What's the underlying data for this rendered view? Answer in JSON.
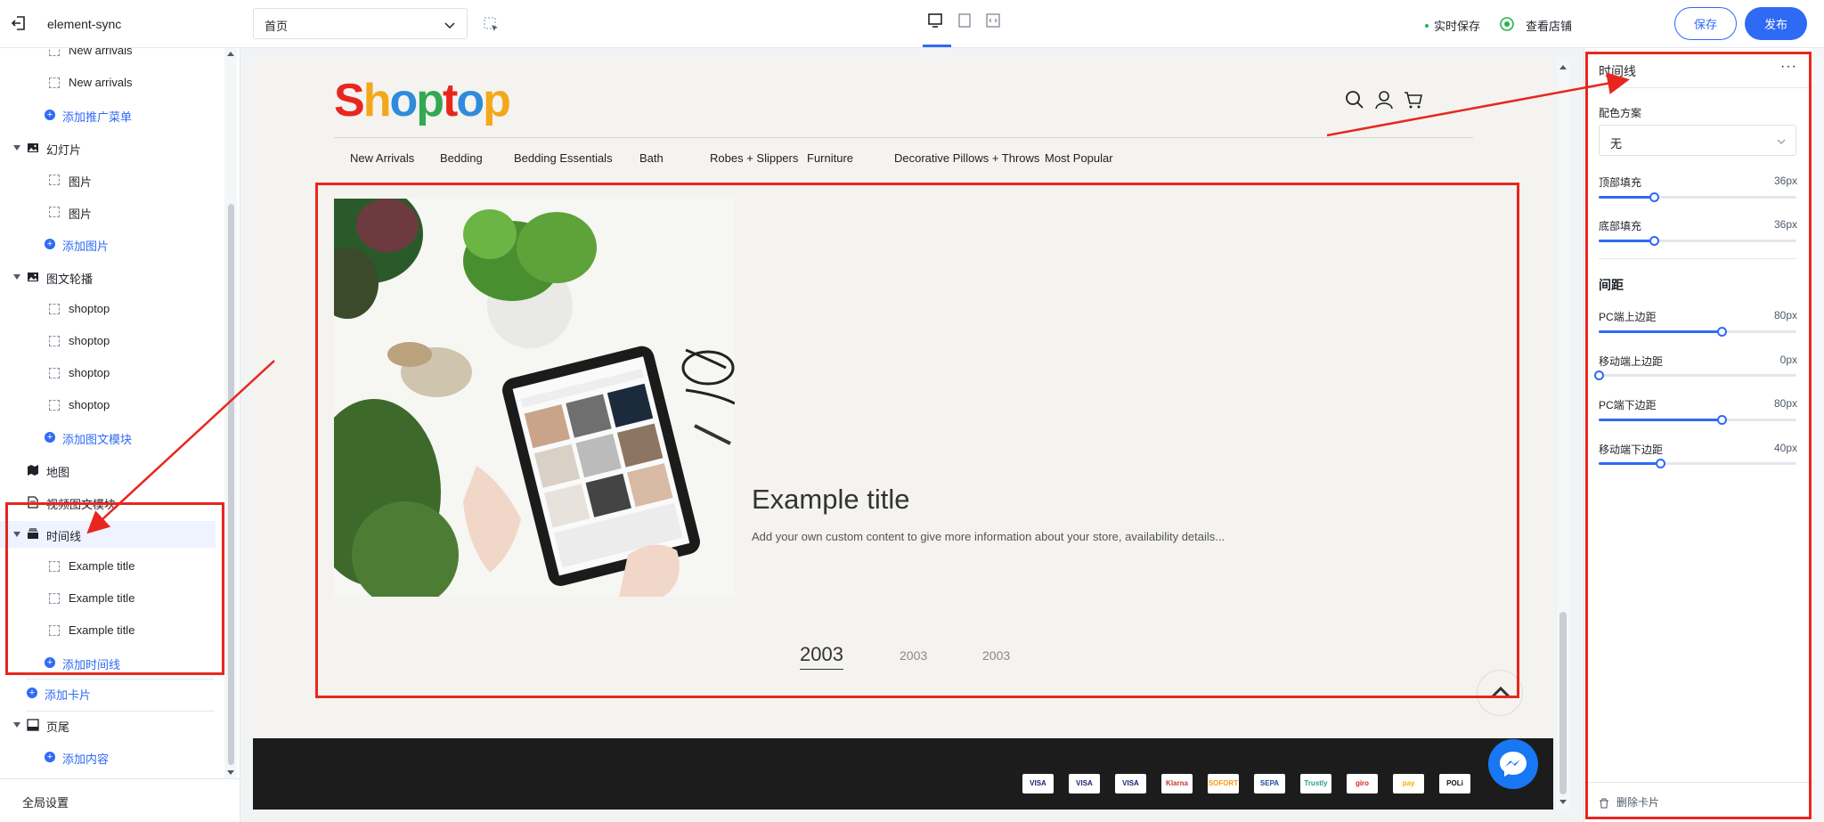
{
  "app": {
    "name": "element-sync"
  },
  "topbar": {
    "page_select": "首页",
    "realtime_save": "实时保存",
    "view_store": "查看店铺",
    "save": "保存",
    "publish": "发布"
  },
  "sidebar": {
    "rows": [
      {
        "kind": "child",
        "label": "New arrivals"
      },
      {
        "kind": "child",
        "label": "New arrivals"
      },
      {
        "kind": "add",
        "label": "添加推广菜单"
      },
      {
        "kind": "section",
        "label": "幻灯片",
        "icon": "image-icon",
        "expanded": true
      },
      {
        "kind": "child",
        "label": "图片"
      },
      {
        "kind": "child",
        "label": "图片"
      },
      {
        "kind": "add",
        "label": "添加图片"
      },
      {
        "kind": "section",
        "label": "图文轮播",
        "icon": "image-icon",
        "expanded": true
      },
      {
        "kind": "child",
        "label": "shoptop"
      },
      {
        "kind": "child",
        "label": "shoptop"
      },
      {
        "kind": "child",
        "label": "shoptop"
      },
      {
        "kind": "child",
        "label": "shoptop"
      },
      {
        "kind": "add",
        "label": "添加图文模块"
      },
      {
        "kind": "section",
        "label": "地图",
        "icon": "map-icon",
        "expanded": false
      },
      {
        "kind": "section",
        "label": "视频图文模块",
        "icon": "document-icon",
        "expanded": false
      },
      {
        "kind": "section",
        "label": "时间线",
        "icon": "layers-icon",
        "expanded": true,
        "selected": true
      },
      {
        "kind": "child",
        "label": "Example title"
      },
      {
        "kind": "child",
        "label": "Example title"
      },
      {
        "kind": "child",
        "label": "Example title"
      },
      {
        "kind": "add",
        "label": "添加时间线"
      },
      {
        "kind": "add-card",
        "label": "添加卡片"
      },
      {
        "kind": "section",
        "label": "页尾",
        "icon": "footer-icon",
        "expanded": true
      },
      {
        "kind": "add",
        "label": "添加内容"
      }
    ],
    "global_settings": "全局设置"
  },
  "preview": {
    "logo": "Shoptop",
    "logo_colors": [
      "#e8261f",
      "#f3a81b",
      "#2f8bdc",
      "#34a853",
      "#e8261f",
      "#2f8bdc",
      "#f3a81b"
    ],
    "nav": [
      "New Arrivals",
      "Bedding",
      "Bedding Essentials",
      "Bath",
      "Robes + Slippers",
      "Furniture",
      "Decorative Pillows + Throws",
      "Most Popular"
    ],
    "timeline": {
      "title": "Example title",
      "description": "Add your own custom content to give more information about your store, availability details...",
      "years": [
        "2003",
        "2003",
        "2003"
      ]
    },
    "payments": [
      "VISA",
      "VISA",
      "VISA",
      "Klarna",
      "SOFORT",
      "SEPA",
      "Trustly",
      "giro",
      "pay",
      "POLi"
    ]
  },
  "panel": {
    "title": "时间线",
    "color_scheme_label": "配色方案",
    "color_scheme_value": "无",
    "top_padding": {
      "label": "顶部填充",
      "value": "36px",
      "level": 0.28
    },
    "bottom_padding": {
      "label": "底部填充",
      "value": "36px",
      "level": 0.28
    },
    "spacing_title": "间距",
    "pc_top": {
      "label": "PC端上边距",
      "value": "80px",
      "level": 0.62
    },
    "mobile_top": {
      "label": "移动端上边距",
      "value": "0px",
      "level": 0
    },
    "pc_bottom": {
      "label": "PC端下边距",
      "value": "80px",
      "level": 0.62
    },
    "mobile_bottom": {
      "label": "移动端下边距",
      "value": "40px",
      "level": 0.31
    },
    "delete_card": "删除卡片"
  },
  "colors": {
    "accent": "#2f6af5",
    "annotation": "#e8261f"
  }
}
